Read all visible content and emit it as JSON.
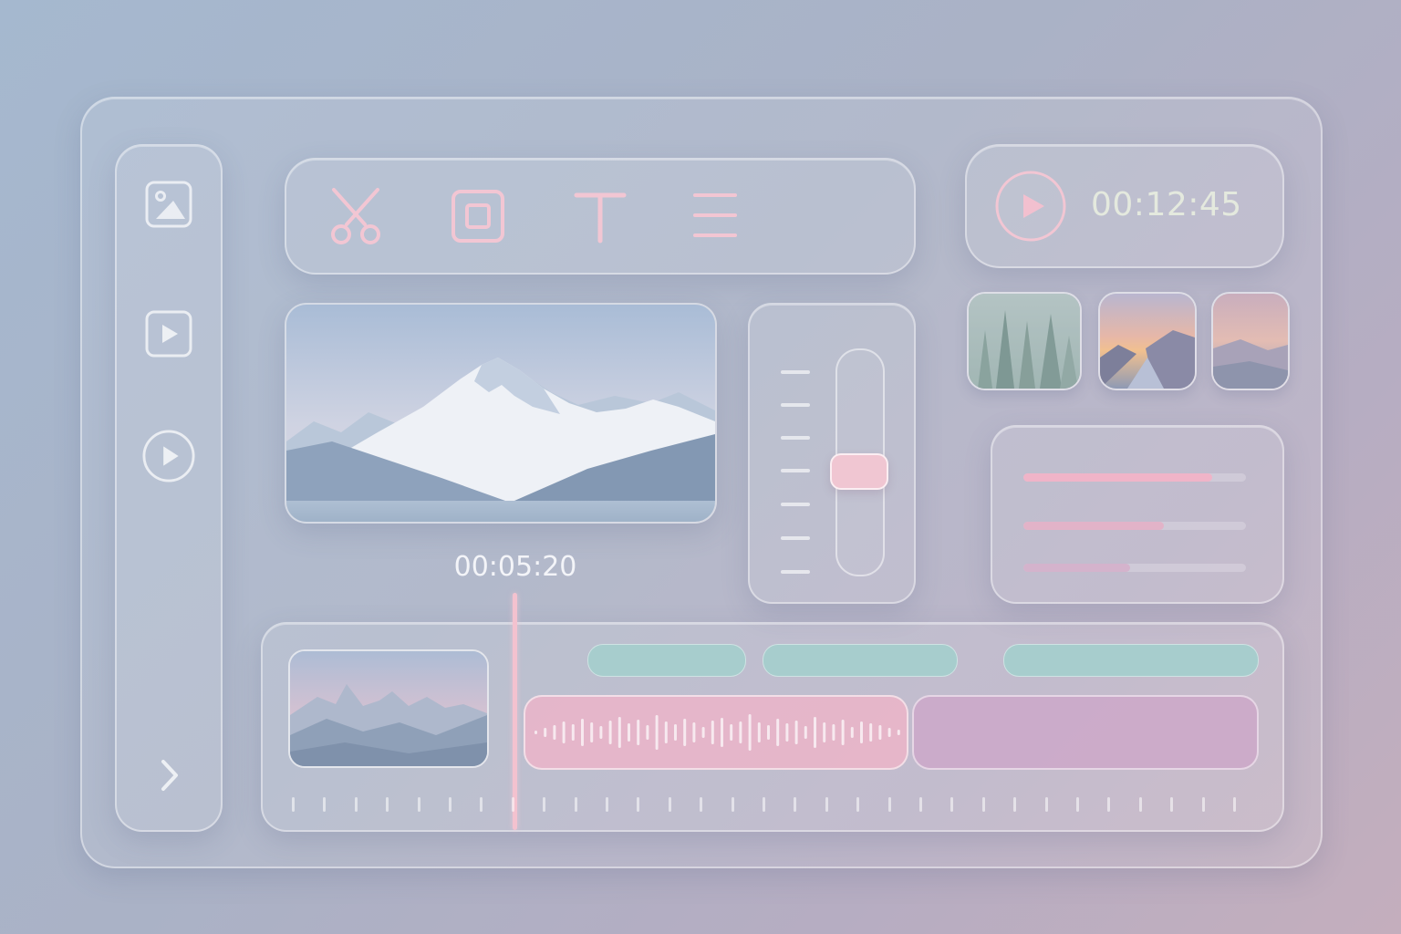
{
  "player": {
    "duration": "00:12:45",
    "play_icon": "play-icon"
  },
  "preview": {
    "playhead_time": "00:05:20",
    "image": "mountain-landscape"
  },
  "toolbar": {
    "tools": [
      "scissors-icon",
      "crop-icon",
      "text-icon",
      "menu-icon"
    ]
  },
  "sidebar": {
    "items": [
      "image-icon",
      "video-icon",
      "play-circle-icon",
      "chevron-right-icon"
    ]
  },
  "media_thumbnails": [
    "misty-forest",
    "sunset-river",
    "foggy-shore"
  ],
  "slider": {
    "value": 0.45
  },
  "levels": [
    0.85,
    0.63,
    0.48
  ],
  "colors": {
    "accent_pink": "#f0b4c8",
    "caption_teal": "#a7cdcd",
    "audio_pink": "#f0b4c8",
    "audio_mauve": "#cda5c8",
    "text_light": "#f3f4f8"
  }
}
